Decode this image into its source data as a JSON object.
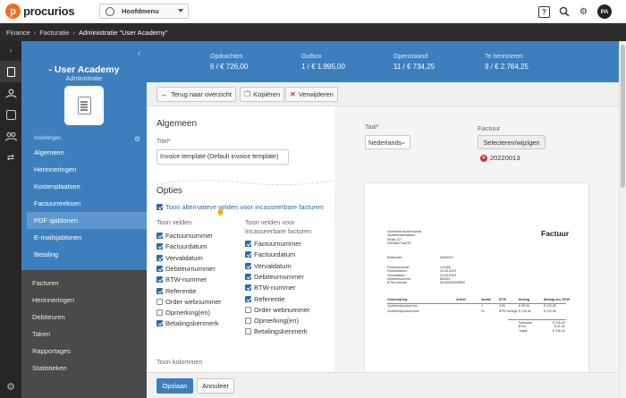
{
  "brand": {
    "name": "procurios"
  },
  "mainmenu": {
    "label": "Hoofdmenu"
  },
  "topbar": {
    "help": "?",
    "avatar": "PA"
  },
  "breadcrumb": {
    "items": [
      "Finance",
      "Facturatie",
      "Administratie \"User Academy\""
    ],
    "sep": "›"
  },
  "sidebar": {
    "title": "- User Academy",
    "subtitle": "Administratie",
    "section_label": "Instellingen",
    "settings_items": [
      "Algemeen",
      "Herinneringen",
      "Kostenplaatsen",
      "Factuurreeksen",
      "PDF sjablonen",
      "E-mailsjablonen",
      "Betaling"
    ],
    "active_item": "PDF sjablonen",
    "nav_items": [
      "Facturen",
      "Herinneringen",
      "Debiteuren",
      "Taken",
      "Rapportages",
      "Statistieken"
    ]
  },
  "stats": [
    {
      "label": "Opdrachten",
      "value": "6 / € 726,00"
    },
    {
      "label": "Outbox",
      "value": "1 / € 1.995,00"
    },
    {
      "label": "Openstaand",
      "value": "11 / € 734,25"
    },
    {
      "label": "Te herinneren",
      "value": "9 / € 2.764,25"
    }
  ],
  "toolbar": {
    "back": "Terug naar overzicht",
    "copy": "Kopiëren",
    "delete": "Verwijderen"
  },
  "form": {
    "general_heading": "Algemeen",
    "title_label": "Titel",
    "title_value": "Invoice template (Default invoice template)",
    "options_heading": "Opties",
    "alt_fields_label": "Toon alternatieve velden voor incasseerbare facturen",
    "col1_heading": "Toon velden",
    "col2_heading": "Toon velden voor incasseerbare facturen",
    "columns_heading": "Toon kolommen",
    "fields": [
      {
        "label": "Factuurnummer",
        "checked": true
      },
      {
        "label": "Factuurdatum",
        "checked": true
      },
      {
        "label": "Vervaldatum",
        "checked": true
      },
      {
        "label": "Debiteurnummer",
        "checked": true
      },
      {
        "label": "BTW-nummer",
        "checked": true
      },
      {
        "label": "Referentie",
        "checked": true
      },
      {
        "label": "Order webnummer",
        "checked": false
      },
      {
        "label": "Opmerking(en)",
        "checked": false
      },
      {
        "label": "Betalingskenmerk",
        "checked": true
      }
    ],
    "fields_collectable": [
      {
        "label": "Factuurnummer",
        "checked": true
      },
      {
        "label": "Factuurdatum",
        "checked": true
      },
      {
        "label": "Vervaldatum",
        "checked": true
      },
      {
        "label": "Debiteurnummer",
        "checked": true
      },
      {
        "label": "BTW-nummer",
        "checked": true
      },
      {
        "label": "Referentie",
        "checked": true
      },
      {
        "label": "Order webnummer",
        "checked": false
      },
      {
        "label": "Opmerking(en)",
        "checked": false
      },
      {
        "label": "Betalingskenmerk",
        "checked": false
      }
    ]
  },
  "preview": {
    "language_label": "Taal",
    "language_value": "Nederlands",
    "invoice_label": "Factuur",
    "invoice_button": "Selecteren/wijzigen",
    "invoice_number": "20220013",
    "doc": {
      "title": "Factuur",
      "address": [
        "Voorbeeld bookhouseda",
        "Voorbeeldstraatekst",
        "Straat 127",
        "0000AB PLAATS"
      ],
      "reference_label": "Referentie:",
      "reference_value": "AA00000",
      "meta_labels": [
        "Factuurnummer:",
        "Factuurdatum:",
        "Vervaldatum:",
        "Debiteurnummer:",
        "BTW-nummer:"
      ],
      "meta_values": [
        "123456",
        "20-03-2023",
        "24-03-2023",
        "654321",
        "NL000000000B00"
      ],
      "table_headers": [
        "Omschrijving",
        "Artikel",
        "Aantal",
        "BTW",
        "Bedrag",
        "Bedrag incl. BTW"
      ],
      "rows": [
        [
          "Voorbeeldproduct een",
          "",
          "1",
          "21%",
          "€ 99,99",
          "€ 120,99"
        ],
        [
          "Voorbeeldproduct twee",
          "",
          "21",
          "BTW verlegd",
          "€ 125,45",
          "€ 122,45"
        ]
      ],
      "totals_labels": [
        "Subtotaal",
        "BTW",
        "Totaal"
      ],
      "totals_values": [
        "€ 225,44",
        "€ 21,00",
        "€ 246,44"
      ]
    }
  },
  "footer": {
    "save": "Opslaan",
    "cancel": "Annuleer"
  },
  "colors": {
    "brand_orange": "#f06c22",
    "primary_blue": "#3d7fbd",
    "active_blue": "#5e98cf",
    "danger_red": "#d9332a"
  }
}
